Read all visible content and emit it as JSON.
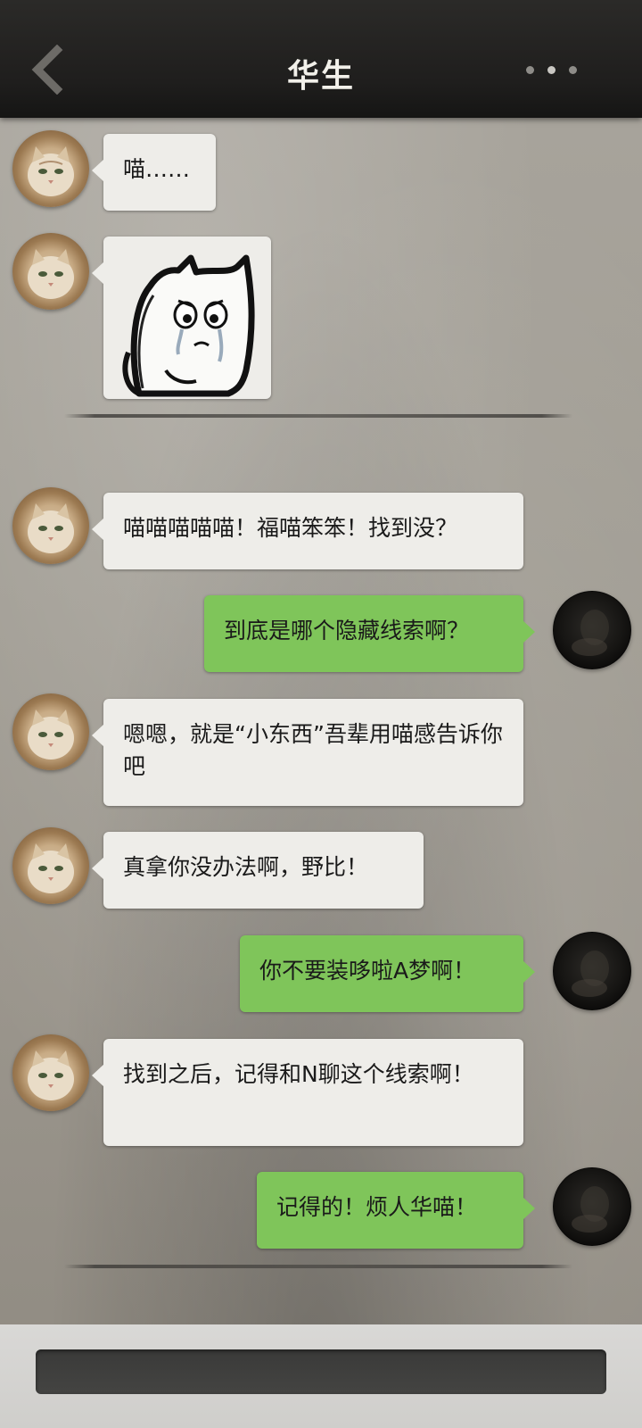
{
  "header": {
    "title": "华生",
    "back_icon": "chevron-left-icon",
    "more_icon": "more-dots-icon"
  },
  "messages": [
    {
      "sender": "华生",
      "side": "in",
      "text": "喵……"
    },
    {
      "sender": "华生",
      "side": "in",
      "type": "sticker",
      "sticker": "crying-cat-sticker"
    },
    {
      "sender": "华生",
      "side": "in",
      "text": "喵喵喵喵喵！福喵笨笨！找到没？"
    },
    {
      "sender": "me",
      "side": "out",
      "text": "到底是哪个隐藏线索啊？"
    },
    {
      "sender": "华生",
      "side": "in",
      "text": "嗯嗯，就是“小东西”吾辈用喵感告诉你吧"
    },
    {
      "sender": "华生",
      "side": "in",
      "text": "真拿你没办法啊，野比！"
    },
    {
      "sender": "me",
      "side": "out",
      "text": "你不要装哆啦A梦啊！"
    },
    {
      "sender": "华生",
      "side": "in",
      "text": "找到之后，记得和N聊这个线索啊！"
    },
    {
      "sender": "me",
      "side": "out",
      "text": "记得的！烦人华喵！"
    }
  ],
  "colors": {
    "incoming_bubble": "#eeede9",
    "outgoing_bubble": "#7fc55a",
    "header_bg": "#1f1e1d",
    "title_text": "#f2f0ea"
  }
}
